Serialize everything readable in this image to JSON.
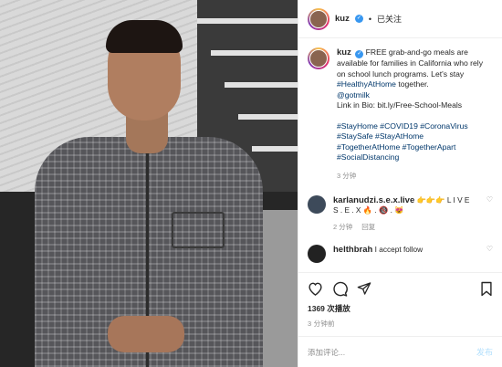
{
  "header": {
    "username": "kuz",
    "separator": "•",
    "follow_status": "已关注"
  },
  "caption": {
    "username": "kuz",
    "line1": "FREE grab-and-go meals are available for families in California who rely on school lunch programs. Let's stay ",
    "hashtag_healthy": "#HealthyAtHome",
    "line1_end": " together.",
    "mention": "@gotmilk",
    "bio": "Link in Bio: bit.ly/Free-School-Meals",
    "hashtags": [
      [
        "#StayHome",
        "#COVID19",
        "#CoronaVirus"
      ],
      [
        "#StaySafe",
        "#StayAtHome"
      ],
      [
        "#TogetherAtHome",
        "#TogetherApart"
      ],
      [
        "#SocialDistancing"
      ]
    ],
    "time": "3 分钟"
  },
  "comments": [
    {
      "username": "karlanudzi.s.e.x.live",
      "text": "👉👉👉 L I V E  S . E . X 🔥 . 🔞 . 😻",
      "time": "2 分钟",
      "reply": "回复"
    },
    {
      "username": "helthbrah",
      "text": "I accept follow"
    }
  ],
  "actions": {
    "likes": "1369 次播放",
    "posted": "3 分钟前"
  },
  "composer": {
    "placeholder": "添加评论...",
    "post_label": "发布"
  },
  "colors": {
    "link": "#00376b",
    "verified": "#3897f0",
    "post_button": "#b2dffc"
  }
}
